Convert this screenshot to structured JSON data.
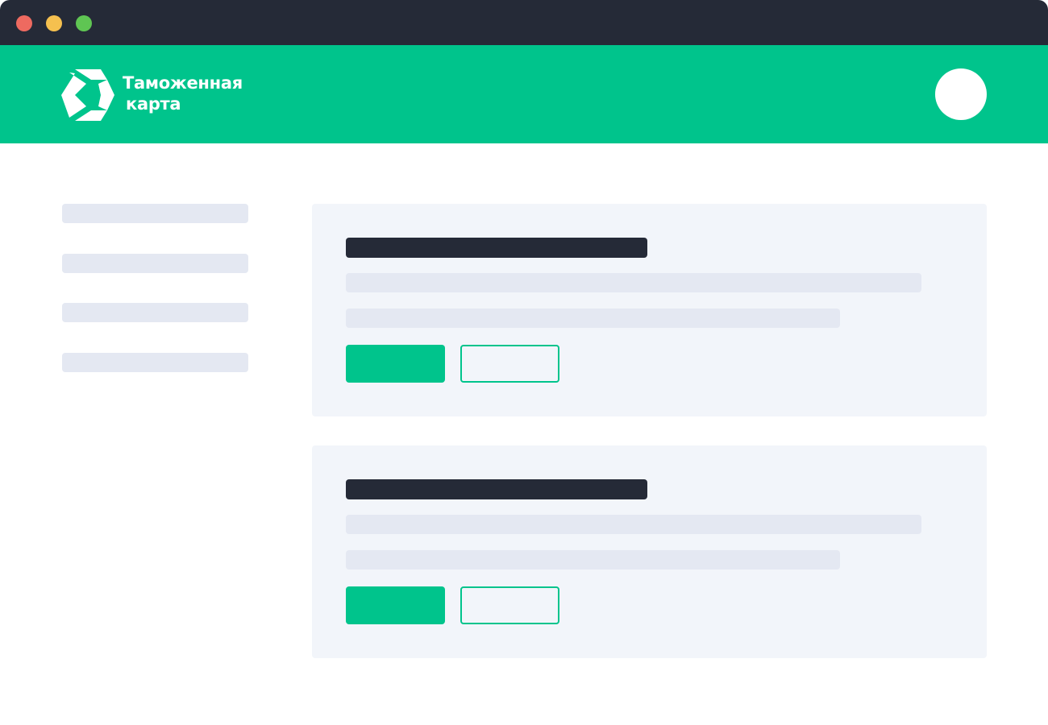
{
  "window": {
    "controls": [
      {
        "name": "close",
        "color": "#ee6a60"
      },
      {
        "name": "minimize",
        "color": "#f5c04f"
      },
      {
        "name": "maximize",
        "color": "#5fc553"
      }
    ]
  },
  "header": {
    "brand_line1": "Таможенная",
    "brand_line2": "карта",
    "logo_icon": "hexagon-logo-icon",
    "avatar_icon": "user-avatar-circle"
  },
  "sidebar": {
    "items": [
      {},
      {},
      {},
      {}
    ]
  },
  "cards": [
    {},
    {}
  ],
  "colors": {
    "chrome": "#252a37",
    "brand": "#00c48c",
    "placeholder": "#e4e8f2",
    "card_bg": "#f2f5fa",
    "title_placeholder": "#252a37"
  }
}
